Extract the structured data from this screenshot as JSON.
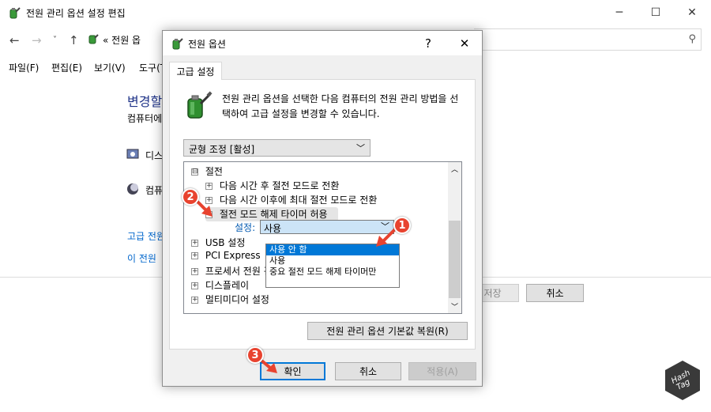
{
  "bg_window": {
    "title": "전원 관리 옵션 설정 편집",
    "address": "« 전원 옵",
    "menu": [
      "파일(F)",
      "편집(E)",
      "보기(V)",
      "도구(T)"
    ],
    "heading": "변경할",
    "subtext": "컴퓨터에",
    "item1": "디스",
    "item2": "컴퓨",
    "link1": "고급 전원",
    "link2": "이 전원",
    "save_button": "저장",
    "cancel_button": "취소"
  },
  "dialog": {
    "title": "전원 옵션",
    "help": "?",
    "close": "✕",
    "tab": "고급 설정",
    "description": "전원 관리 옵션을 선택한 다음 컴퓨터의 전원 관리 방법을 선택하여 고급 설정을 변경할 수 있습니다.",
    "plan_select": "균형 조정 [활성]",
    "tree": [
      {
        "label": "절전",
        "expander": "⊟"
      },
      {
        "label": "다음 시간 후 절전 모드로 전환",
        "expander": "+"
      },
      {
        "label": "다음 시간 이후에 최대 절전 모드로 전환",
        "expander": "+"
      },
      {
        "label": "절전 모드 해제 타이머 허용",
        "expander": "−"
      },
      {
        "label": "USB 설정",
        "expander": "+"
      },
      {
        "label": "PCI Express",
        "expander": "+"
      },
      {
        "label": "프로세서 전원 관리",
        "expander": "+"
      },
      {
        "label": "디스플레이",
        "expander": "+"
      },
      {
        "label": "멀티미디어 설정",
        "expander": "+"
      }
    ],
    "setting_label": "설정:",
    "setting_value": "사용",
    "dropdown_options": [
      "사용 안 함",
      "사용",
      "중요 절전 모드 해제 타이머만"
    ],
    "restore_button": "전원 관리 옵션 기본값 복원(R)",
    "ok_button": "확인",
    "cancel_button": "취소",
    "apply_button": "적용(A)"
  },
  "badges": [
    "1",
    "2",
    "3"
  ],
  "watermark": "Hash Tag",
  "colors": {
    "selection": "#0078d7",
    "badge": "#e8432f",
    "link": "#0066cc",
    "heading": "#1e3287"
  }
}
